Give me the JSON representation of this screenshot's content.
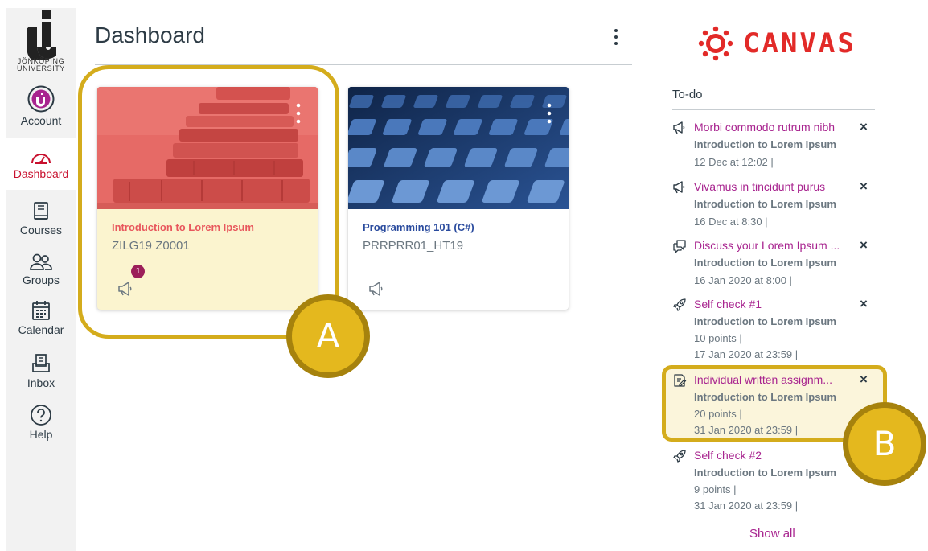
{
  "nav": {
    "logo_text": "JÖNKÖPING\nUNIVERSITY",
    "items": [
      {
        "label": "Account",
        "icon": "account-avatar-icon"
      },
      {
        "label": "Dashboard",
        "icon": "dashboard-gauge-icon",
        "active": true
      },
      {
        "label": "Courses",
        "icon": "courses-book-icon"
      },
      {
        "label": "Groups",
        "icon": "groups-people-icon"
      },
      {
        "label": "Calendar",
        "icon": "calendar-icon"
      },
      {
        "label": "Inbox",
        "icon": "inbox-icon"
      },
      {
        "label": "Help",
        "icon": "help-question-icon"
      }
    ]
  },
  "main": {
    "title": "Dashboard",
    "cards": [
      {
        "name": "Introduction to Lorem Ipsum",
        "code": "ZILG19 Z0001",
        "badge": "1",
        "color": "#e8575d",
        "name_color": "#e8575d"
      },
      {
        "name": "Programming 101 (C#)",
        "code": "PRRPRR01_HT19",
        "color": "#1d3e72",
        "name_color": "#2a4b9e"
      }
    ]
  },
  "callouts": {
    "a": "A",
    "b": "B"
  },
  "sidebar": {
    "brand": "CANVAS",
    "todo_heading": "To-do",
    "items": [
      {
        "icon": "announcement-icon",
        "title": "Morbi commodo rutrum nibh",
        "course": "Introduction to Lorem Ipsum",
        "meta": [
          "12 Dec at 12:02  |"
        ]
      },
      {
        "icon": "announcement-icon",
        "title": "Vivamus in tincidunt purus",
        "course": "Introduction to Lorem Ipsum",
        "meta": [
          "16 Dec at 8:30  |"
        ]
      },
      {
        "icon": "discussion-icon",
        "title": "Discuss your Lorem Ipsum ...",
        "course": "Introduction to Lorem Ipsum",
        "meta": [
          "16 Jan 2020 at 8:00  |"
        ]
      },
      {
        "icon": "quiz-rocket-icon",
        "title": "Self check #1",
        "course": "Introduction to Lorem Ipsum",
        "meta": [
          "10 points  |",
          "17 Jan 2020 at 23:59  |"
        ]
      },
      {
        "icon": "assignment-icon",
        "title": "Individual written assignm...",
        "course": "Introduction to Lorem Ipsum",
        "meta": [
          "20 points  |",
          "31 Jan 2020 at 23:59  |"
        ]
      },
      {
        "icon": "quiz-rocket-icon",
        "title": "Self check #2",
        "course": "Introduction to Lorem Ipsum",
        "meta": [
          "9 points  |",
          "31 Jan 2020 at 23:59  |"
        ]
      }
    ],
    "dismiss": "×",
    "show_all": "Show all"
  }
}
